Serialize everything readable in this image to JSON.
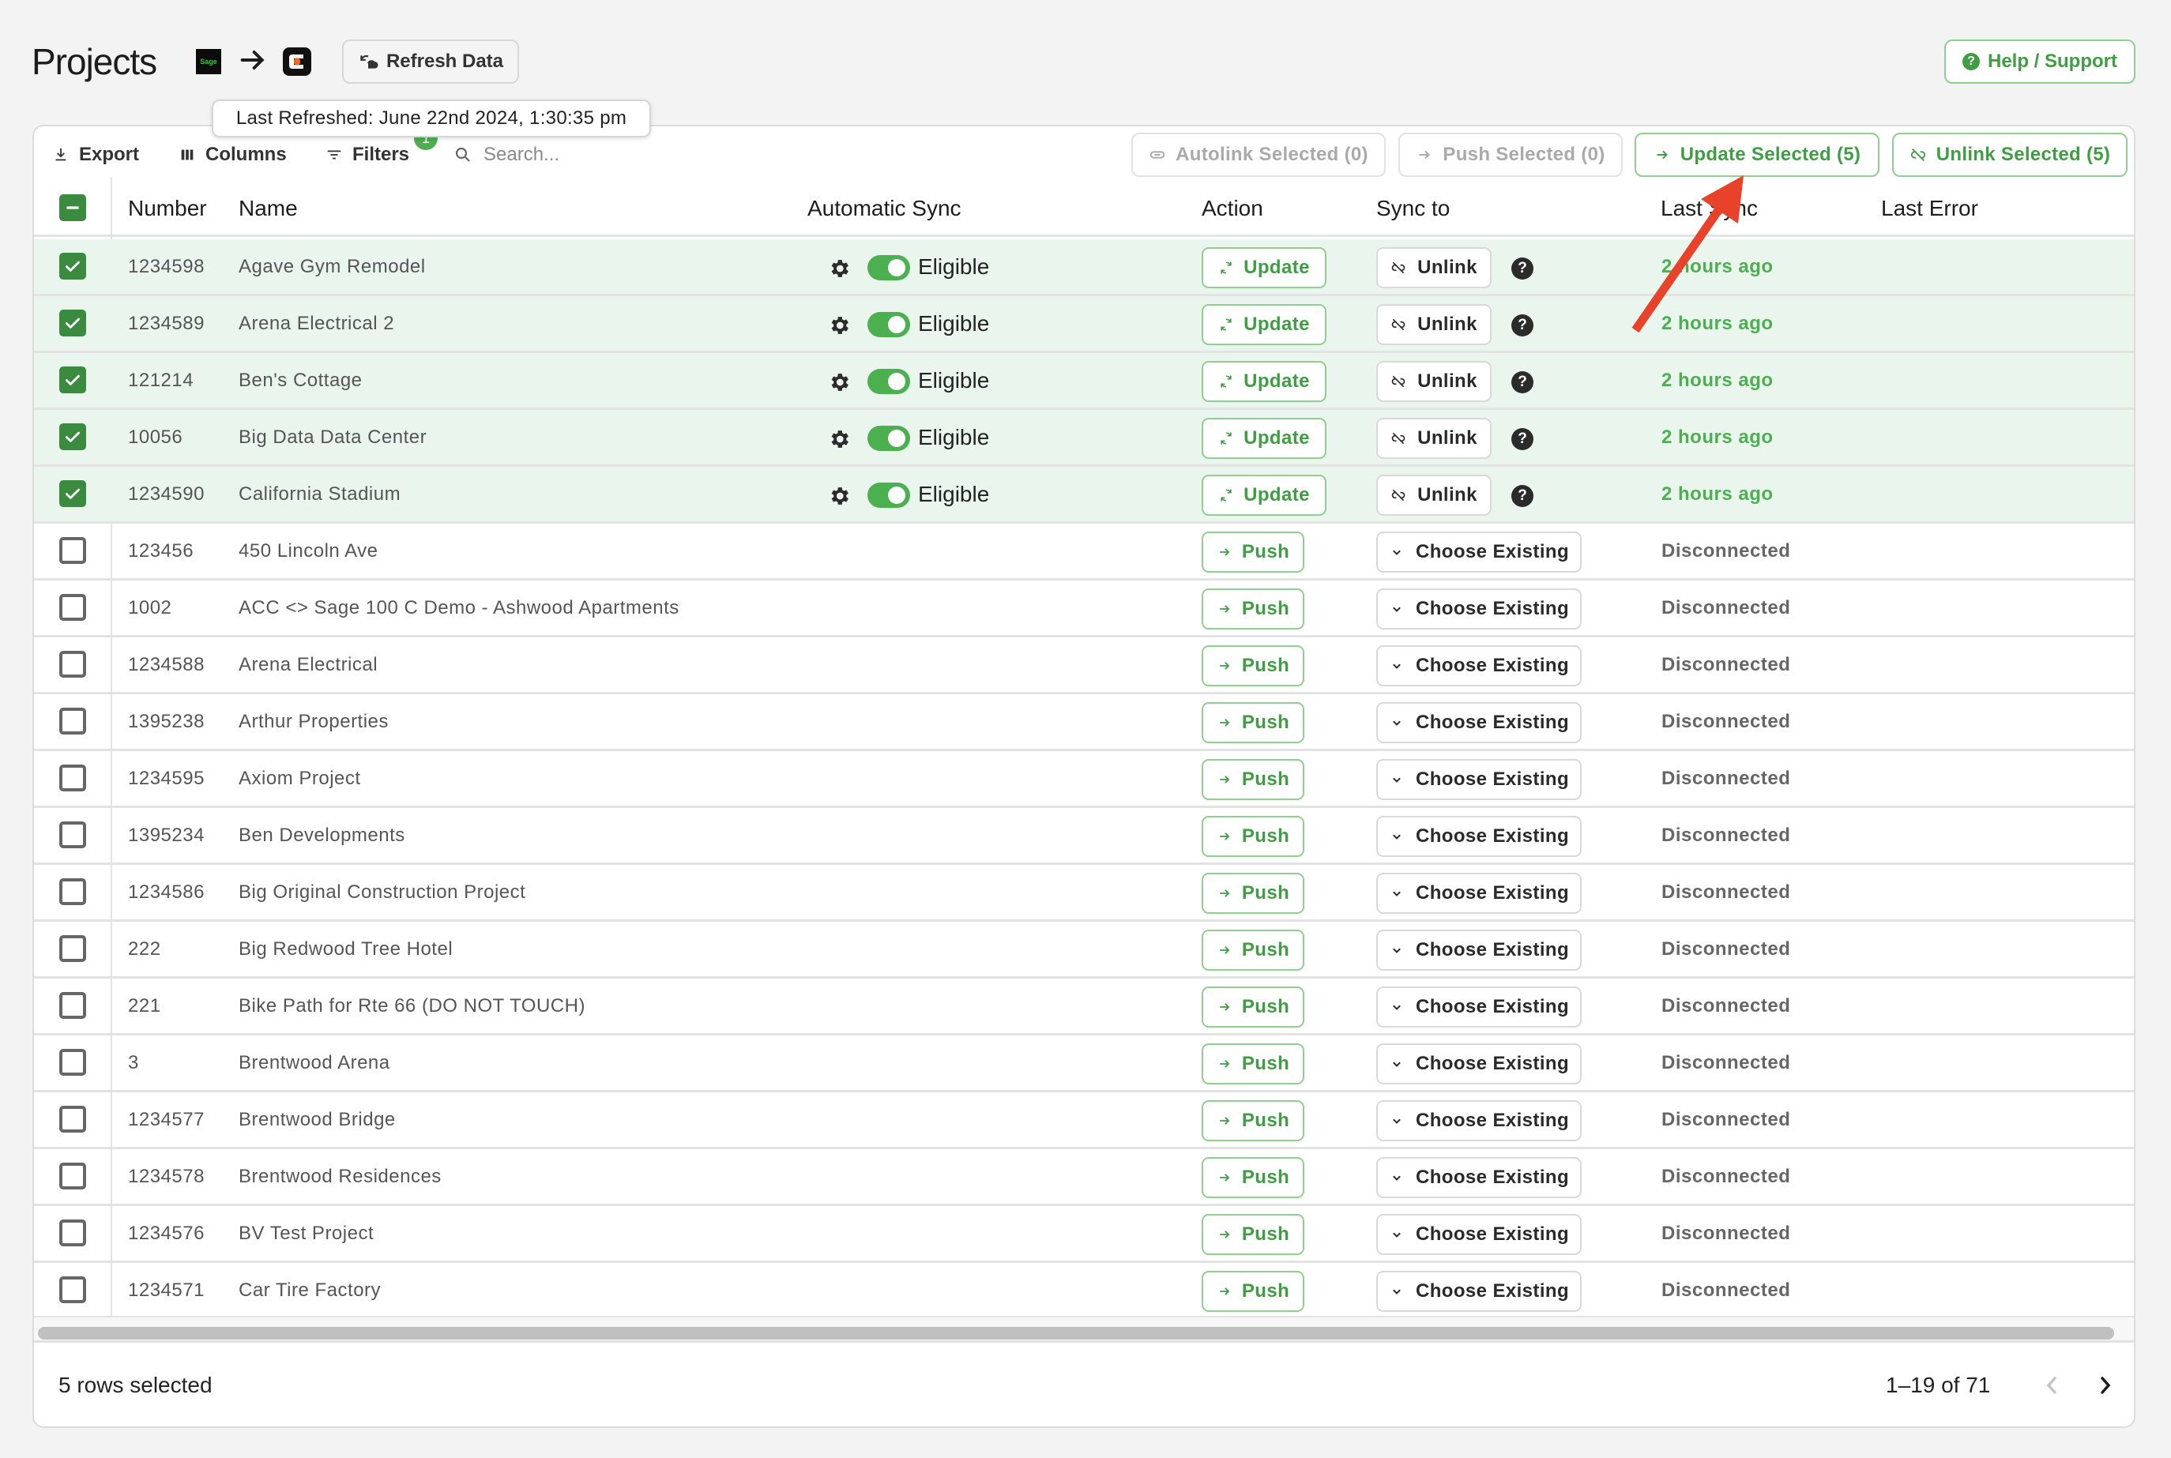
{
  "header": {
    "title": "Projects",
    "source_logo_text": "Sage",
    "refresh_label": "Refresh Data",
    "last_refreshed_tooltip": "Last Refreshed: June 22nd 2024, 1:30:35 pm",
    "help_label": "Help / Support"
  },
  "toolbar": {
    "export_label": "Export",
    "columns_label": "Columns",
    "filters_label": "Filters",
    "filters_badge": "1",
    "search_placeholder": "Search...",
    "autolink_label": "Autolink Selected (0)",
    "push_selected_label": "Push Selected (0)",
    "update_selected_label": "Update Selected (5)",
    "unlink_selected_label": "Unlink Selected (5)"
  },
  "columns": {
    "number": "Number",
    "name": "Name",
    "automatic_sync": "Automatic Sync",
    "action": "Action",
    "sync_to": "Sync to",
    "last_sync": "Last Sync",
    "last_error": "Last Error"
  },
  "rows": [
    {
      "number": "1234598",
      "name": "Agave Gym Remodel",
      "selected": true,
      "auto_sync": "Eligible",
      "action": "Update",
      "sync_to": "Unlink",
      "last_sync": "2 hours ago",
      "last_error": ""
    },
    {
      "number": "1234589",
      "name": "Arena Electrical 2",
      "selected": true,
      "auto_sync": "Eligible",
      "action": "Update",
      "sync_to": "Unlink",
      "last_sync": "2 hours ago",
      "last_error": ""
    },
    {
      "number": "121214",
      "name": "Ben's Cottage",
      "selected": true,
      "auto_sync": "Eligible",
      "action": "Update",
      "sync_to": "Unlink",
      "last_sync": "2 hours ago",
      "last_error": ""
    },
    {
      "number": "10056",
      "name": "Big Data Data Center",
      "selected": true,
      "auto_sync": "Eligible",
      "action": "Update",
      "sync_to": "Unlink",
      "last_sync": "2 hours ago",
      "last_error": ""
    },
    {
      "number": "1234590",
      "name": "California Stadium",
      "selected": true,
      "auto_sync": "Eligible",
      "action": "Update",
      "sync_to": "Unlink",
      "last_sync": "2 hours ago",
      "last_error": ""
    },
    {
      "number": "123456",
      "name": "450 Lincoln Ave",
      "selected": false,
      "auto_sync": "",
      "action": "Push",
      "sync_to": "Choose Existing",
      "last_sync": "Disconnected",
      "last_error": ""
    },
    {
      "number": "1002",
      "name": "ACC <> Sage 100 C Demo - Ashwood Apartments",
      "selected": false,
      "auto_sync": "",
      "action": "Push",
      "sync_to": "Choose Existing",
      "last_sync": "Disconnected",
      "last_error": ""
    },
    {
      "number": "1234588",
      "name": "Arena Electrical",
      "selected": false,
      "auto_sync": "",
      "action": "Push",
      "sync_to": "Choose Existing",
      "last_sync": "Disconnected",
      "last_error": ""
    },
    {
      "number": "1395238",
      "name": "Arthur Properties",
      "selected": false,
      "auto_sync": "",
      "action": "Push",
      "sync_to": "Choose Existing",
      "last_sync": "Disconnected",
      "last_error": ""
    },
    {
      "number": "1234595",
      "name": "Axiom Project",
      "selected": false,
      "auto_sync": "",
      "action": "Push",
      "sync_to": "Choose Existing",
      "last_sync": "Disconnected",
      "last_error": ""
    },
    {
      "number": "1395234",
      "name": "Ben Developments",
      "selected": false,
      "auto_sync": "",
      "action": "Push",
      "sync_to": "Choose Existing",
      "last_sync": "Disconnected",
      "last_error": ""
    },
    {
      "number": "1234586",
      "name": "Big Original Construction Project",
      "selected": false,
      "auto_sync": "",
      "action": "Push",
      "sync_to": "Choose Existing",
      "last_sync": "Disconnected",
      "last_error": ""
    },
    {
      "number": "222",
      "name": "Big Redwood Tree Hotel",
      "selected": false,
      "auto_sync": "",
      "action": "Push",
      "sync_to": "Choose Existing",
      "last_sync": "Disconnected",
      "last_error": ""
    },
    {
      "number": "221",
      "name": "Bike Path for Rte 66 (DO NOT TOUCH)",
      "selected": false,
      "auto_sync": "",
      "action": "Push",
      "sync_to": "Choose Existing",
      "last_sync": "Disconnected",
      "last_error": ""
    },
    {
      "number": "3",
      "name": "Brentwood Arena",
      "selected": false,
      "auto_sync": "",
      "action": "Push",
      "sync_to": "Choose Existing",
      "last_sync": "Disconnected",
      "last_error": ""
    },
    {
      "number": "1234577",
      "name": "Brentwood Bridge",
      "selected": false,
      "auto_sync": "",
      "action": "Push",
      "sync_to": "Choose Existing",
      "last_sync": "Disconnected",
      "last_error": ""
    },
    {
      "number": "1234578",
      "name": "Brentwood Residences",
      "selected": false,
      "auto_sync": "",
      "action": "Push",
      "sync_to": "Choose Existing",
      "last_sync": "Disconnected",
      "last_error": ""
    },
    {
      "number": "1234576",
      "name": "BV Test Project",
      "selected": false,
      "auto_sync": "",
      "action": "Push",
      "sync_to": "Choose Existing",
      "last_sync": "Disconnected",
      "last_error": ""
    },
    {
      "number": "1234571",
      "name": "Car Tire Factory",
      "selected": false,
      "auto_sync": "",
      "action": "Push",
      "sync_to": "Choose Existing",
      "last_sync": "Disconnected",
      "last_error": ""
    }
  ],
  "footer": {
    "selection_status": "5 rows selected",
    "page_range": "1–19 of 71"
  },
  "colors": {
    "accent_green": "#4caf50",
    "checkbox_green": "#3a8a3f",
    "selected_row_bg": "#eaf5ee",
    "annotation_red": "#e8432a"
  }
}
